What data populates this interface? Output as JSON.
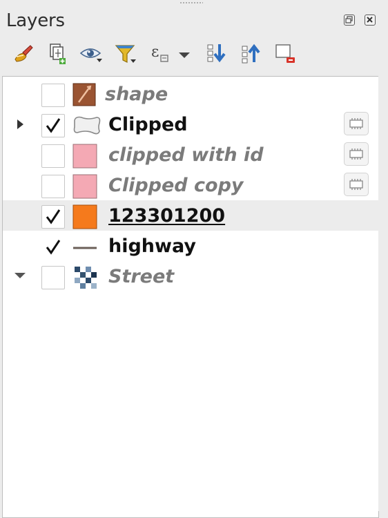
{
  "panel": {
    "title": "Layers"
  },
  "toolbar": {
    "buttons": [
      {
        "icon": "style-brush-icon"
      },
      {
        "icon": "add-group-icon"
      },
      {
        "icon": "visibility-eye-icon"
      },
      {
        "icon": "filter-legend-icon"
      },
      {
        "icon": "filter-expression-icon",
        "label": "ε"
      },
      {
        "icon": "dropdown-arrow-icon"
      },
      {
        "icon": "expand-all-icon"
      },
      {
        "icon": "collapse-all-icon"
      },
      {
        "icon": "remove-layer-icon"
      }
    ]
  },
  "layers": [
    {
      "name": "shape",
      "checked": false,
      "symbol": "raster-brown",
      "style": "dim",
      "expander": "none",
      "memory": false
    },
    {
      "name": "Clipped",
      "checked": true,
      "symbol": "polygon-outline",
      "style": "bold",
      "expander": "collapsed",
      "memory": true
    },
    {
      "name": "clipped with id",
      "checked": false,
      "symbol": "fill",
      "symbol_color": "#f4a9b4",
      "style": "dim",
      "expander": "none",
      "memory": true
    },
    {
      "name": "Clipped copy",
      "checked": false,
      "symbol": "fill",
      "symbol_color": "#f4a9b4",
      "style": "dim",
      "expander": "none",
      "memory": true
    },
    {
      "name": "123301200",
      "checked": true,
      "symbol": "fill",
      "symbol_color": "#f57a1c",
      "style": "bold-underline",
      "expander": "none",
      "memory": false,
      "selected": true
    },
    {
      "name": "highway",
      "checked": true,
      "symbol": "line",
      "symbol_color": "#6b5f58",
      "style": "bold",
      "expander": "none",
      "memory": false
    },
    {
      "name": "Street",
      "checked": false,
      "symbol": "raster-checker",
      "style": "dim",
      "expander": "expanded",
      "memory": false
    }
  ]
}
